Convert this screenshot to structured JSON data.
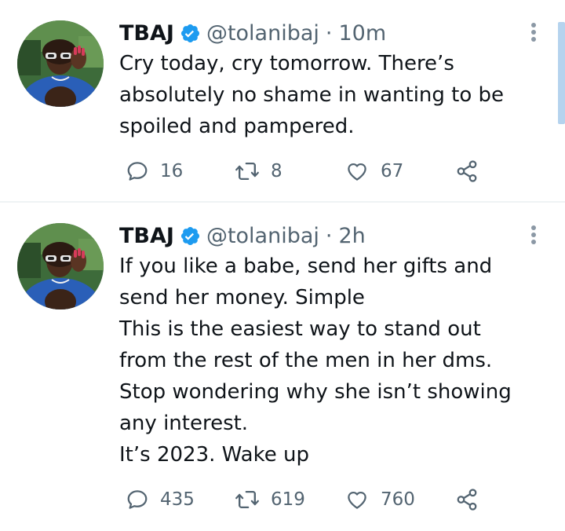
{
  "tweets": [
    {
      "author_name": "TBAJ",
      "handle": "@tolanibaj",
      "separator": "·",
      "time": "10m",
      "text_lines": [
        "Cry today, cry tomorrow. There’s",
        "absolutely no shame in wanting to be",
        "spoiled and pampered."
      ],
      "replies": "16",
      "retweets": "8",
      "likes": "67"
    },
    {
      "author_name": "TBAJ",
      "handle": "@tolanibaj",
      "separator": "·",
      "time": "2h",
      "text_lines": [
        "If you like a babe, send her gifts and",
        "send her money. Simple",
        "This is the easiest way to stand out",
        "from the rest of the men in her dms.",
        "Stop wondering why she isn’t showing",
        "any interest.",
        "It’s 2023. Wake up"
      ],
      "replies": "435",
      "retweets": "619",
      "likes": "760"
    }
  ],
  "icons": {
    "verified": "verified-badge-icon",
    "more": "more-vertical-icon",
    "reply": "reply-bubble-icon",
    "retweet": "retweet-icon",
    "like": "heart-icon",
    "share": "share-icon"
  },
  "colors": {
    "text": "#0f1419",
    "secondary": "#536471",
    "verified": "#1d9bf0",
    "divider": "#eff3f4"
  }
}
